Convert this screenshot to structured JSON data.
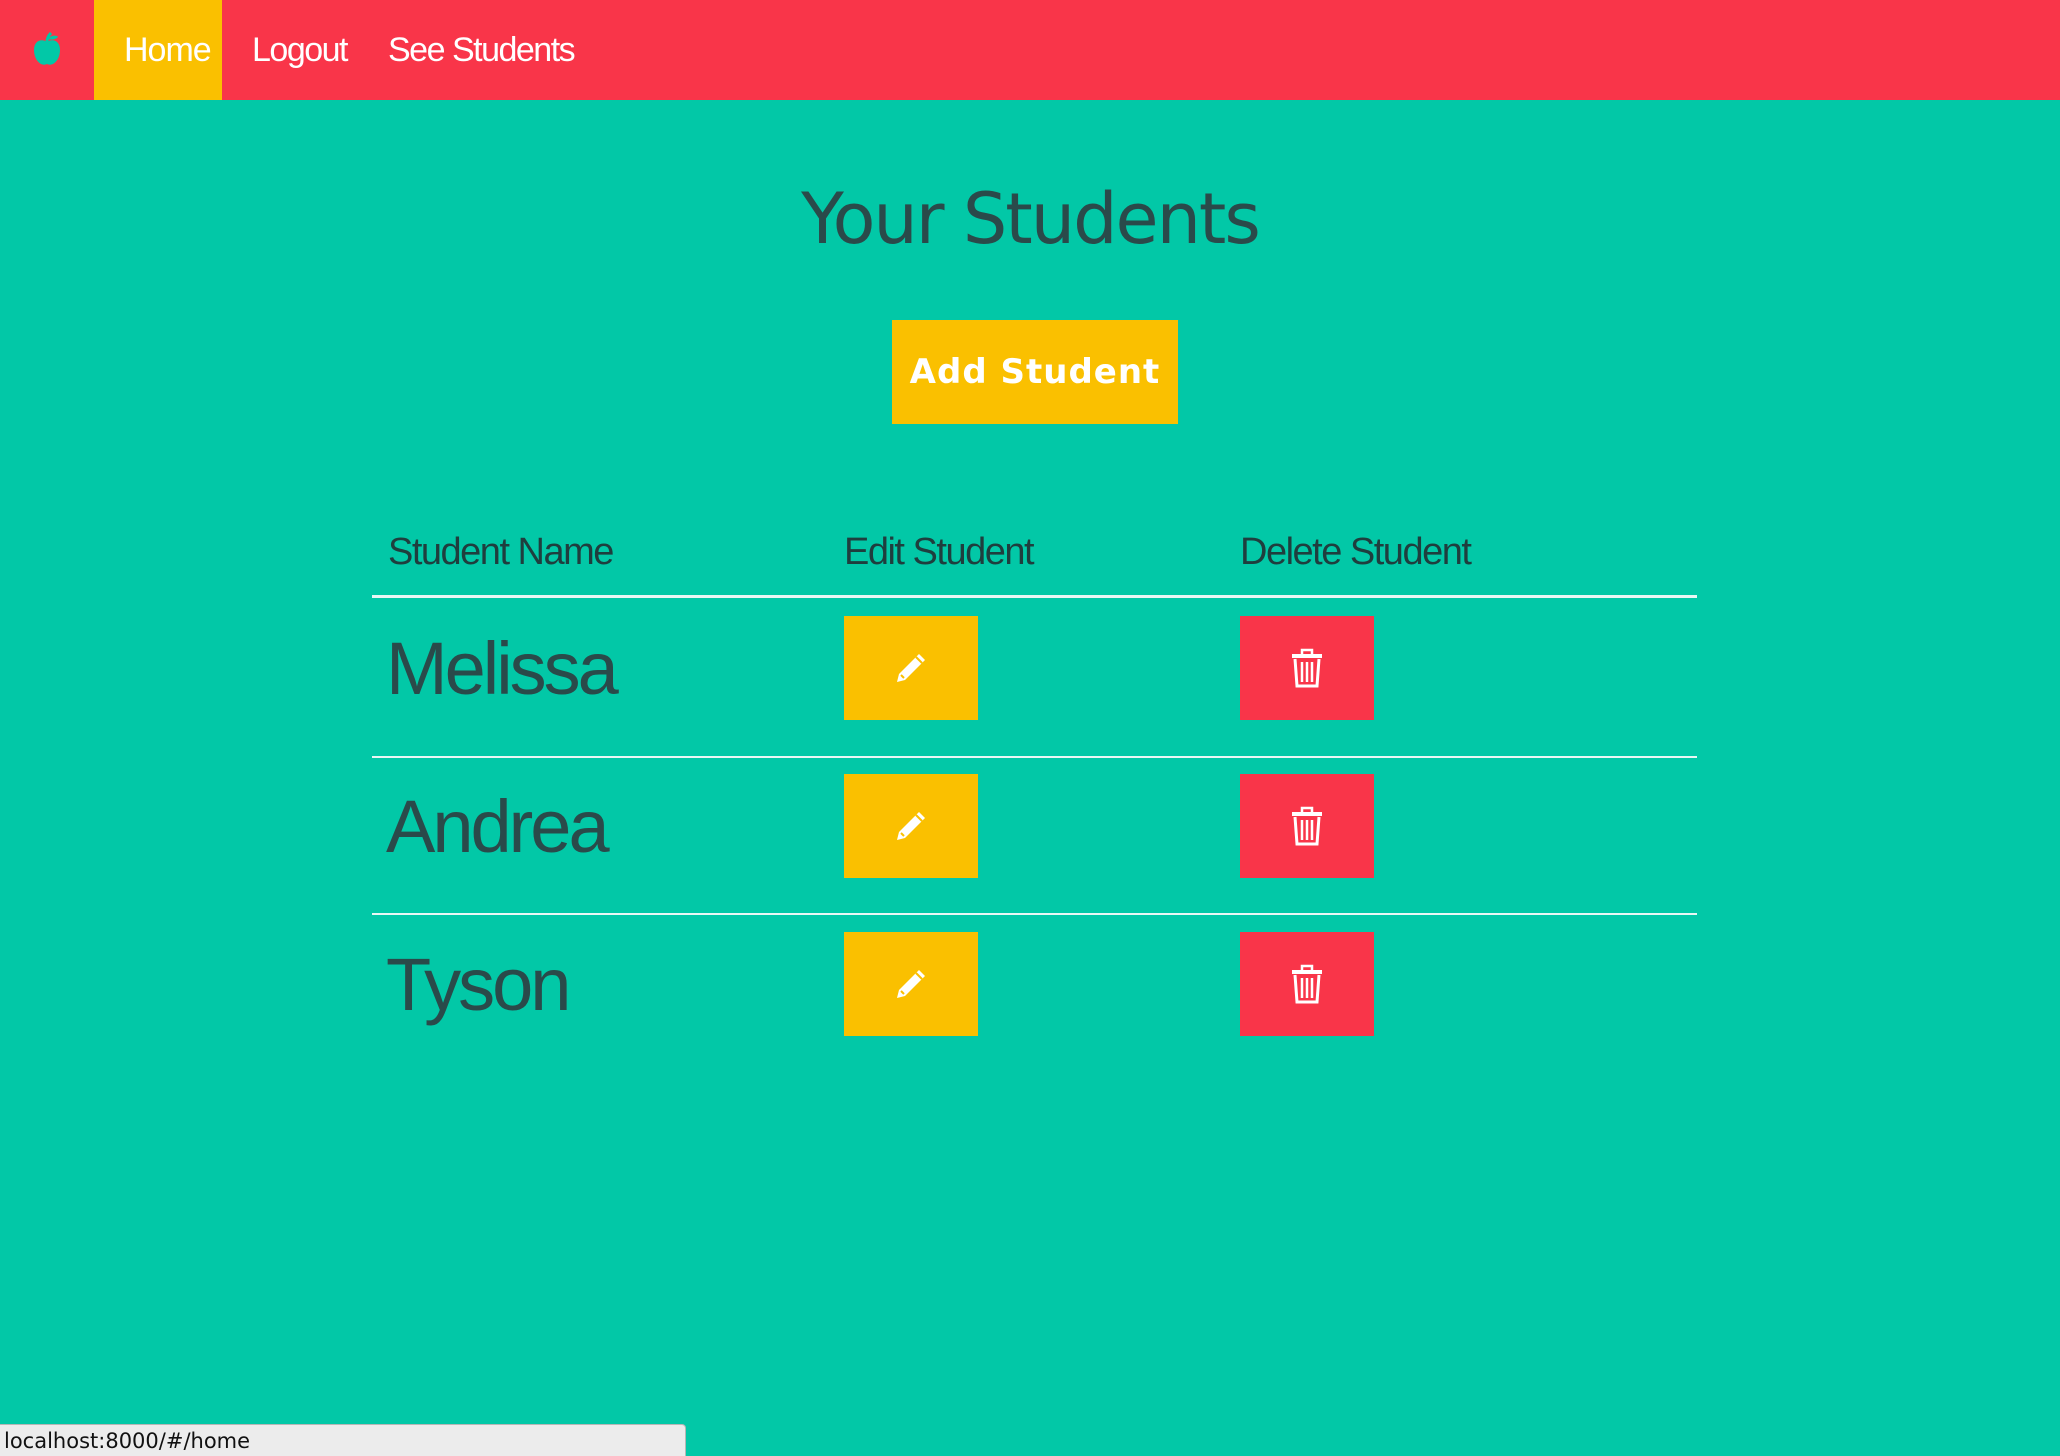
{
  "nav": {
    "brand_icon": "apple-icon",
    "items": [
      {
        "label": "Home",
        "active": true
      },
      {
        "label": "Logout",
        "active": false
      },
      {
        "label": "See Students",
        "active": false
      }
    ]
  },
  "main": {
    "title": "Your Students",
    "add_button_label": "Add Student",
    "table": {
      "headers": [
        "Student Name",
        "Edit Student",
        "Delete Student"
      ],
      "rows": [
        {
          "name": "Melissa"
        },
        {
          "name": "Andrea"
        },
        {
          "name": "Tyson"
        }
      ],
      "edit_icon": "pencil-icon",
      "delete_icon": "trash-icon"
    }
  },
  "status_bar": {
    "url": "localhost:8000/#/home"
  },
  "colors": {
    "background": "#02c8a7",
    "navbar": "#f93549",
    "accent_yellow": "#fac000",
    "danger_red": "#f93549",
    "text_dark": "#2a4a4a"
  }
}
